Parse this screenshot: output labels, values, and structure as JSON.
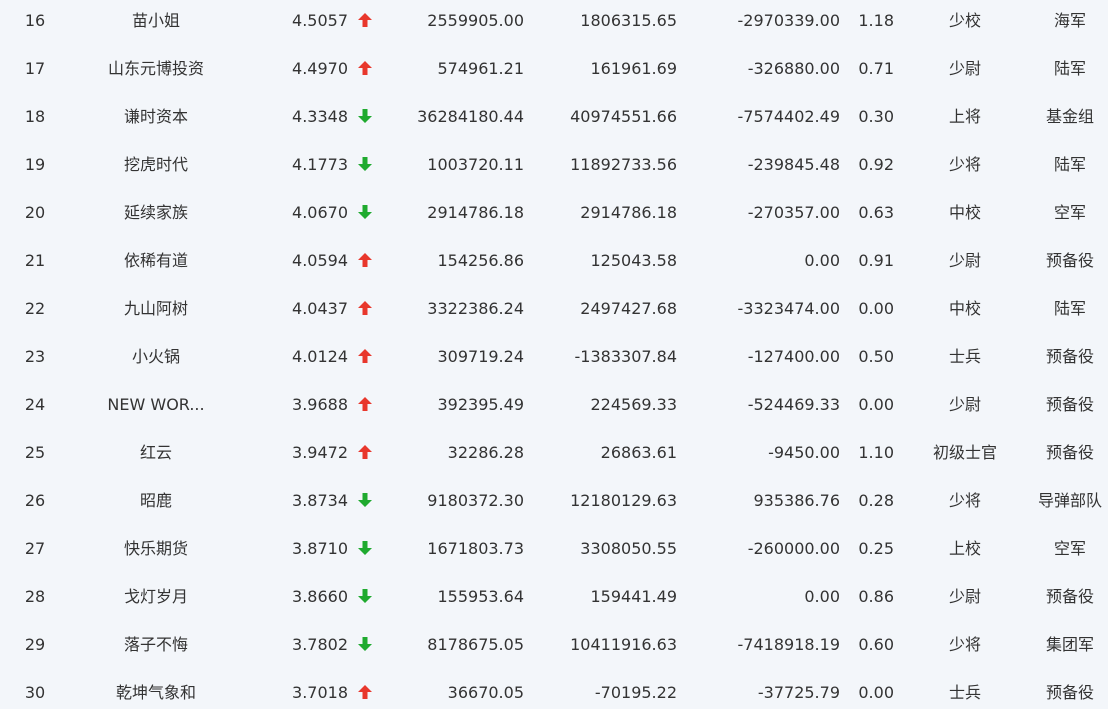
{
  "colors": {
    "background": "#f3f6fa",
    "text": "#333333",
    "up": "#e8372c",
    "down": "#1faa2f"
  },
  "rows": [
    {
      "rank": "16",
      "name": "苗小姐",
      "score": "4.5057",
      "trend": "up-arrow-icon",
      "v1": "2559905.00",
      "v2": "1806315.65",
      "v3": "-2970339.00",
      "ratio": "1.18",
      "level": "少校",
      "unit": "海军"
    },
    {
      "rank": "17",
      "name": "山东元博投资",
      "score": "4.4970",
      "trend": "up-arrow-icon",
      "v1": "574961.21",
      "v2": "161961.69",
      "v3": "-326880.00",
      "ratio": "0.71",
      "level": "少尉",
      "unit": "陆军"
    },
    {
      "rank": "18",
      "name": "谦时资本",
      "score": "4.3348",
      "trend": "down-arrow-icon",
      "v1": "36284180.44",
      "v2": "40974551.66",
      "v3": "-7574402.49",
      "ratio": "0.30",
      "level": "上将",
      "unit": "基金组"
    },
    {
      "rank": "19",
      "name": "挖虎时代",
      "score": "4.1773",
      "trend": "down-arrow-icon",
      "v1": "1003720.11",
      "v2": "11892733.56",
      "v3": "-239845.48",
      "ratio": "0.92",
      "level": "少将",
      "unit": "陆军"
    },
    {
      "rank": "20",
      "name": "延续家族",
      "score": "4.0670",
      "trend": "down-arrow-icon",
      "v1": "2914786.18",
      "v2": "2914786.18",
      "v3": "-270357.00",
      "ratio": "0.63",
      "level": "中校",
      "unit": "空军"
    },
    {
      "rank": "21",
      "name": "依稀有道",
      "score": "4.0594",
      "trend": "up-arrow-icon",
      "v1": "154256.86",
      "v2": "125043.58",
      "v3": "0.00",
      "ratio": "0.91",
      "level": "少尉",
      "unit": "预备役"
    },
    {
      "rank": "22",
      "name": "九山阿树",
      "score": "4.0437",
      "trend": "up-arrow-icon",
      "v1": "3322386.24",
      "v2": "2497427.68",
      "v3": "-3323474.00",
      "ratio": "0.00",
      "level": "中校",
      "unit": "陆军"
    },
    {
      "rank": "23",
      "name": "小火锅",
      "score": "4.0124",
      "trend": "up-arrow-icon",
      "v1": "309719.24",
      "v2": "-1383307.84",
      "v3": "-127400.00",
      "ratio": "0.50",
      "level": "士兵",
      "unit": "预备役"
    },
    {
      "rank": "24",
      "name": "NEW WOR...",
      "score": "3.9688",
      "trend": "up-arrow-icon",
      "v1": "392395.49",
      "v2": "224569.33",
      "v3": "-524469.33",
      "ratio": "0.00",
      "level": "少尉",
      "unit": "预备役"
    },
    {
      "rank": "25",
      "name": "红云",
      "score": "3.9472",
      "trend": "up-arrow-icon",
      "v1": "32286.28",
      "v2": "26863.61",
      "v3": "-9450.00",
      "ratio": "1.10",
      "level": "初级士官",
      "unit": "预备役"
    },
    {
      "rank": "26",
      "name": "昭鹿",
      "score": "3.8734",
      "trend": "down-arrow-icon",
      "v1": "9180372.30",
      "v2": "12180129.63",
      "v3": "935386.76",
      "ratio": "0.28",
      "level": "少将",
      "unit": "导弹部队"
    },
    {
      "rank": "27",
      "name": "快乐期货",
      "score": "3.8710",
      "trend": "down-arrow-icon",
      "v1": "1671803.73",
      "v2": "3308050.55",
      "v3": "-260000.00",
      "ratio": "0.25",
      "level": "上校",
      "unit": "空军"
    },
    {
      "rank": "28",
      "name": "戈灯岁月",
      "score": "3.8660",
      "trend": "down-arrow-icon",
      "v1": "155953.64",
      "v2": "159441.49",
      "v3": "0.00",
      "ratio": "0.86",
      "level": "少尉",
      "unit": "预备役"
    },
    {
      "rank": "29",
      "name": "落子不悔",
      "score": "3.7802",
      "trend": "down-arrow-icon",
      "v1": "8178675.05",
      "v2": "10411916.63",
      "v3": "-7418918.19",
      "ratio": "0.60",
      "level": "少将",
      "unit": "集团军"
    },
    {
      "rank": "30",
      "name": "乾坤气象和",
      "score": "3.7018",
      "trend": "up-arrow-icon",
      "v1": "36670.05",
      "v2": "-70195.22",
      "v3": "-37725.79",
      "ratio": "0.00",
      "level": "士兵",
      "unit": "预备役"
    }
  ]
}
